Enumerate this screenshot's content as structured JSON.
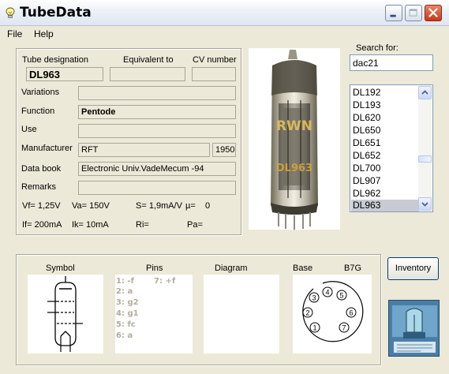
{
  "window": {
    "title": "TubeData",
    "icon": "lightbulb-icon"
  },
  "menu": {
    "file": "File",
    "help": "Help"
  },
  "details": {
    "labels": {
      "designation": "Tube designation",
      "equivalent": "Equivalent to",
      "cv": "CV number",
      "variations": "Variations",
      "function": "Function",
      "use": "Use",
      "manufacturer": "Manufacturer",
      "databook": "Data book",
      "remarks": "Remarks"
    },
    "values": {
      "designation": "DL963",
      "equivalent": "",
      "cv": "",
      "variations": "",
      "function": "Pentode",
      "use": "",
      "manufacturer": "RFT",
      "year": "1950",
      "databook": "Electronic Univ.VadeMecum -94",
      "remarks": ""
    },
    "params": {
      "vf": "Vf= 1,25V",
      "va": "Va= 150V",
      "s": "S= 1,9mA/V",
      "mu": "µ=",
      "mu_val": "0",
      "if": "If= 200mA",
      "ik": "Ik= 10mA",
      "ri": "Ri=",
      "pa": "Pa="
    }
  },
  "photo": {
    "alt_marking": "DL963",
    "brand": "RWN"
  },
  "search": {
    "label": "Search for:",
    "value": "dac21"
  },
  "tube_list": {
    "items": [
      "DL192",
      "DL193",
      "DL620",
      "DL650",
      "DL651",
      "DL652",
      "DL700",
      "DL907",
      "DL962",
      "DL963"
    ],
    "selected": "DL963"
  },
  "bottom": {
    "symbol_header": "Symbol",
    "pins_header": "Pins",
    "diagram_header": "Diagram",
    "base_header": "Base",
    "base_type": "B7G",
    "pins_col1": [
      "1: -f",
      "2: a",
      "3: g2",
      "4: g1",
      "5: fc",
      "6: a"
    ],
    "pins_col2": [
      "7: +f"
    ],
    "base_pins": [
      "1",
      "2",
      "3",
      "4",
      "5",
      "6",
      "7"
    ]
  },
  "buttons": {
    "inventory": "Inventory"
  }
}
